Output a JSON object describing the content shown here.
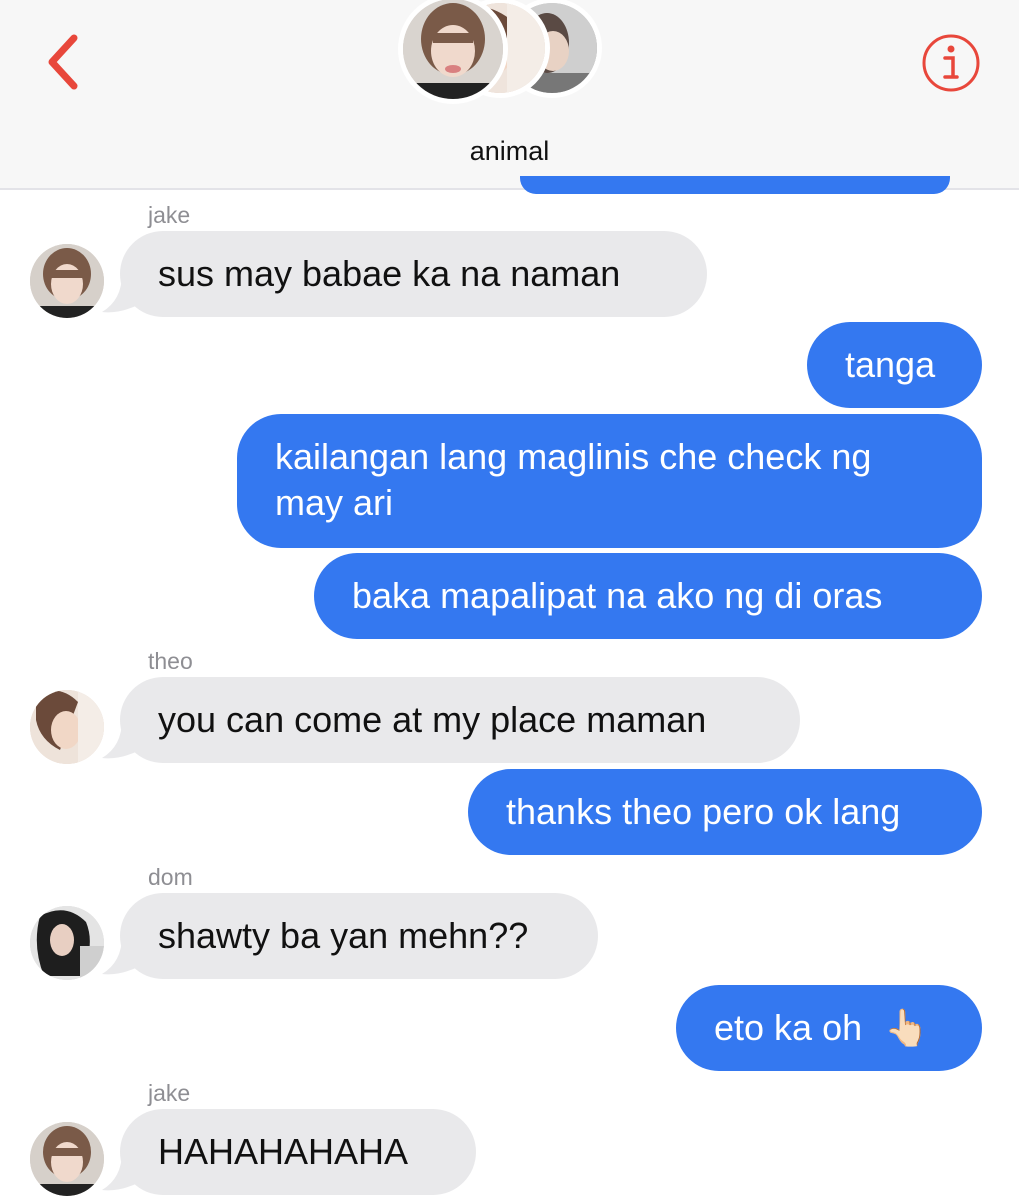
{
  "header": {
    "title": "animal",
    "back_icon": "chevron-left-icon",
    "info_icon": "info-circle-icon",
    "accent_color": "#e8473b"
  },
  "colors": {
    "outgoing": "#3478f0",
    "incoming": "#e9e9eb",
    "sender_name": "#8e8e93"
  },
  "messages": [
    {
      "direction": "in",
      "sender": "jake",
      "text": "sus may babae ka na naman"
    },
    {
      "direction": "out",
      "text": "tanga"
    },
    {
      "direction": "out",
      "text_line1": "kailangan lang maglinis che check ng",
      "text_line2": "may ari"
    },
    {
      "direction": "out",
      "text": "baka mapalipat na ako ng di oras"
    },
    {
      "direction": "in",
      "sender": "theo",
      "text": "you can come at my place maman"
    },
    {
      "direction": "out",
      "text": "thanks theo pero ok lang"
    },
    {
      "direction": "in",
      "sender": "dom",
      "text": "shawty ba yan mehn??"
    },
    {
      "direction": "out",
      "text": "eto ka oh",
      "emoji": "👆🏻",
      "emoji_icon": "pointing-up-emoji"
    },
    {
      "direction": "in",
      "sender": "jake",
      "text": "HAHAHAHAHA"
    }
  ]
}
